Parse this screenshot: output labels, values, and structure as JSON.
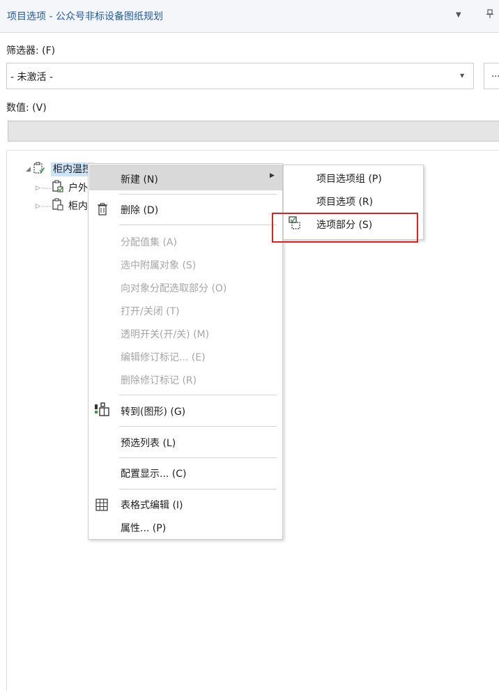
{
  "panel": {
    "title": "项目选项 - 公众号非标设备图纸规划",
    "dropdown_icon": "chevron-down-icon",
    "pin_icon": "pin-icon"
  },
  "filter": {
    "label": "筛选器: (F)",
    "selected": "- 未激活 -",
    "more_label": "..."
  },
  "value": {
    "label": "数值: (V)",
    "current": ""
  },
  "tree": {
    "root_label": "柜内温控",
    "children": [
      {
        "label": "户外"
      },
      {
        "label": "柜内"
      }
    ]
  },
  "context_menu": {
    "items": [
      {
        "label": "新建 (N)",
        "enabled": true,
        "has_submenu": true
      },
      {
        "label": "删除 (D)",
        "enabled": true,
        "icon": "trash-icon"
      },
      {
        "label": "分配值集 (A)",
        "enabled": false
      },
      {
        "label": "选中附属对象 (S)",
        "enabled": false
      },
      {
        "label": "向对象分配选取部分 (O)",
        "enabled": false
      },
      {
        "label": "打开/关闭 (T)",
        "enabled": false
      },
      {
        "label": "透明开关(开/关) (M)",
        "enabled": false
      },
      {
        "label": "编辑修订标记... (E)",
        "enabled": false
      },
      {
        "label": "删除修订标记 (R)",
        "enabled": false
      },
      {
        "label": "转到(图形) (G)",
        "enabled": true,
        "icon": "goto-graphic-icon"
      },
      {
        "label": "预选列表 (L)",
        "enabled": true
      },
      {
        "label": "配置显示... (C)",
        "enabled": true
      },
      {
        "label": "表格式编辑 (I)",
        "enabled": true,
        "icon": "table-grid-icon"
      },
      {
        "label": "属性... (P)",
        "enabled": true
      }
    ]
  },
  "submenu": {
    "items": [
      {
        "label": "项目选项组 (P)"
      },
      {
        "label": "项目选项 (R)"
      },
      {
        "label": "选项部分 (S)",
        "icon": "option-part-icon"
      }
    ]
  },
  "colors": {
    "title_text": "#1f5ba6",
    "selection": "#cde4f8",
    "menu_hover": "#d9d9d9",
    "disabled_text": "#a6a6a6",
    "annotation_box": "#e02020",
    "check_green": "#2e9e3e"
  }
}
